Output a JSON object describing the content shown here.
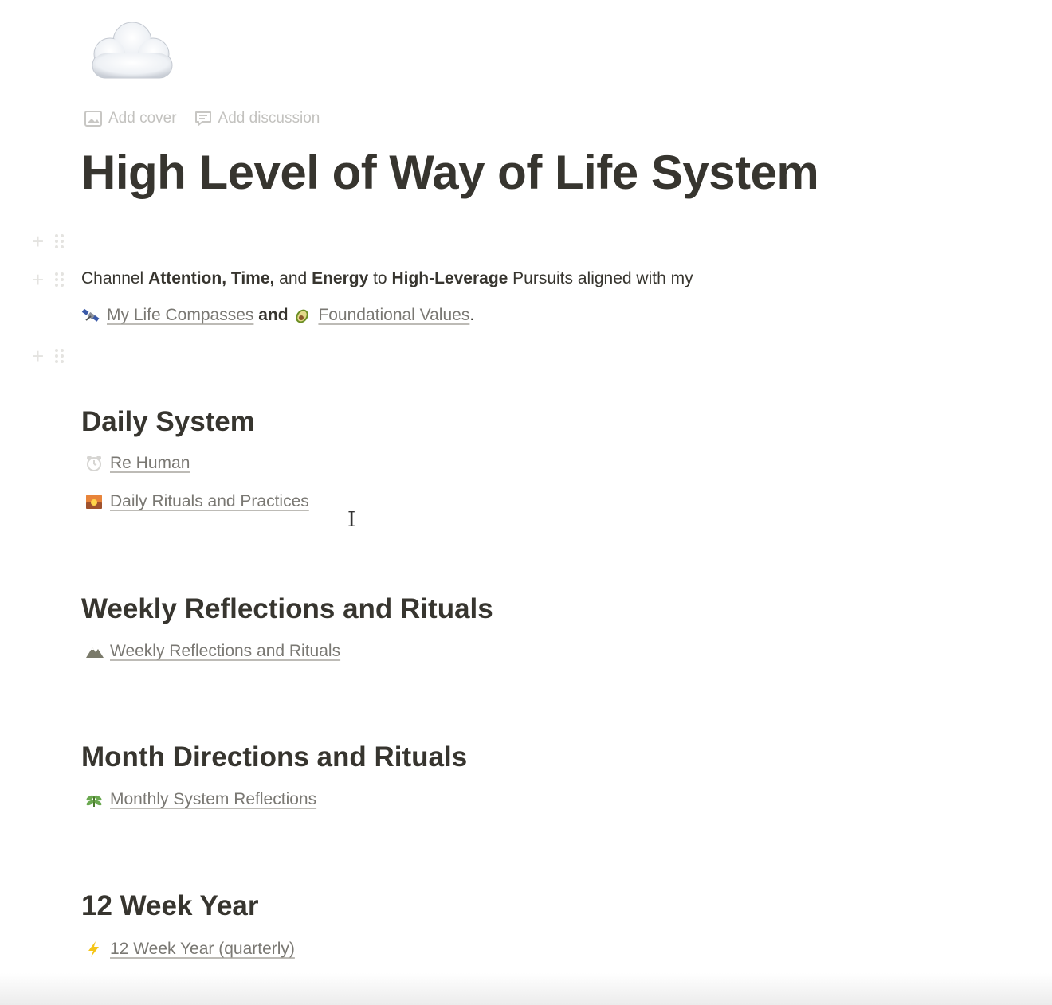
{
  "page": {
    "icon": "cloud-icon",
    "controls": {
      "add_cover": "Add cover",
      "add_discussion": "Add discussion"
    },
    "title": "High Level of Way of Life System"
  },
  "intro": {
    "line1": {
      "t1": "Channel ",
      "b1": "Attention, Time,",
      "t2": " and ",
      "b2": "Energy",
      "t3": " to ",
      "b3": "High-Leverage",
      "t4": " Pursuits aligned with my"
    },
    "line2": {
      "link1": "My Life Compasses",
      "link1_icon": "satellite-icon",
      "and": " and ",
      "link2": "Foundational Values",
      "link2_icon": "avocado-icon",
      "end": "."
    }
  },
  "sections": [
    {
      "heading": "Daily System",
      "links": [
        {
          "label": "Re Human",
          "icon": "clock-icon"
        },
        {
          "label": "Daily Rituals and Practices",
          "icon": "sunrise-icon"
        }
      ]
    },
    {
      "heading": "Weekly Reflections and Rituals",
      "links": [
        {
          "label": "Weekly Reflections and Rituals",
          "icon": "mountain-icon"
        }
      ]
    },
    {
      "heading": "Month Directions and Rituals",
      "links": [
        {
          "label": "Monthly System Reflections",
          "icon": "herb-icon"
        }
      ]
    },
    {
      "heading": "12 Week Year",
      "links": [
        {
          "label": "12 Week Year (quarterly)",
          "icon": "lightning-icon"
        }
      ]
    }
  ],
  "cursor_glyph": "I"
}
